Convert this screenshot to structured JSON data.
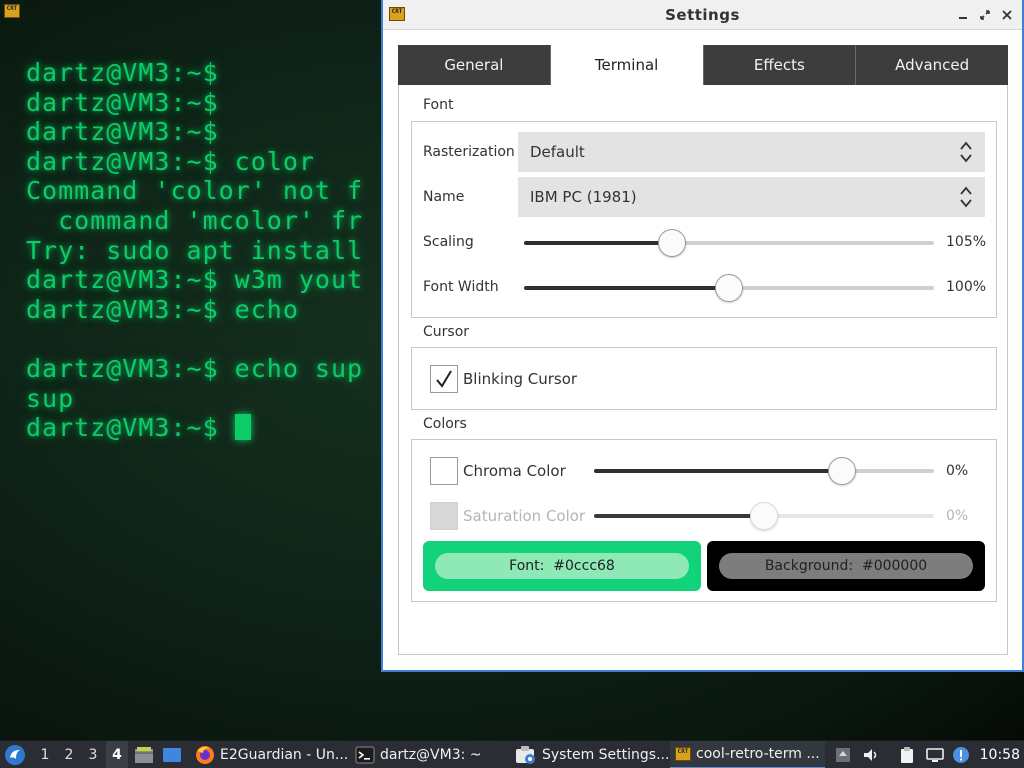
{
  "terminal": {
    "icon_text": "CRT",
    "lines": [
      "dartz@VM3:~$",
      "dartz@VM3:~$",
      "dartz@VM3:~$",
      "dartz@VM3:~$ color",
      "Command 'color' not f",
      "  command 'mcolor' fr",
      "Try: sudo apt install",
      "dartz@VM3:~$ w3m yout",
      "dartz@VM3:~$ echo",
      "",
      "dartz@VM3:~$ echo sup",
      "sup",
      "dartz@VM3:~$ "
    ],
    "color": "#0ccc68"
  },
  "settings": {
    "icon_text": "CRT",
    "title": "Settings",
    "window_controls": {
      "minimize": "–",
      "restore": "⤢",
      "close": "✕"
    },
    "tabs": [
      {
        "label": "General",
        "active": false
      },
      {
        "label": "Terminal",
        "active": true
      },
      {
        "label": "Effects",
        "active": false
      },
      {
        "label": "Advanced",
        "active": false
      }
    ],
    "font_group": {
      "title": "Font",
      "rasterization": {
        "label": "Rasterization",
        "value": "Default"
      },
      "name": {
        "label": "Name",
        "value": "IBM PC (1981)"
      },
      "scaling": {
        "label": "Scaling",
        "value_text": "105%",
        "level": 0.36
      },
      "font_width": {
        "label": "Font Width",
        "value_text": "100%",
        "level": 0.5
      }
    },
    "cursor_group": {
      "title": "Cursor",
      "blinking": {
        "label": "Blinking Cursor",
        "checked": true
      }
    },
    "colors_group": {
      "title": "Colors",
      "chroma": {
        "label": "Chroma Color",
        "value_text": "0%",
        "level": 0.73,
        "checked": false
      },
      "saturation": {
        "label": "Saturation Color",
        "value_text": "0%",
        "level": 0.5,
        "enabled": false
      },
      "font_button": {
        "prefix": "Font:",
        "value": "#0ccc68",
        "outer_color": "#13d37a",
        "inner_color": "#8fe9b7"
      },
      "background_button": {
        "prefix": "Background:",
        "value": "#000000",
        "outer_color": "#000000",
        "inner_color": "#7d7d7d"
      }
    }
  },
  "taskbar": {
    "workspaces": [
      "1",
      "2",
      "3",
      "4"
    ],
    "active_workspace": "4",
    "tasks": [
      {
        "icon": "firefox-icon",
        "label": "E2Guardian - Un..."
      },
      {
        "icon": "terminal-icon",
        "label": "dartz@VM3: ~"
      },
      {
        "icon": "system-settings-icon",
        "label": "System Settings..."
      },
      {
        "icon": "cool-retro-term-icon",
        "label": "cool-retro-term ...",
        "active": true
      }
    ],
    "tray_icons": [
      "upload-icon",
      "volume-icon",
      "clipboard-icon",
      "display-icon",
      "update-notifier-icon"
    ],
    "clock": "10:58"
  }
}
